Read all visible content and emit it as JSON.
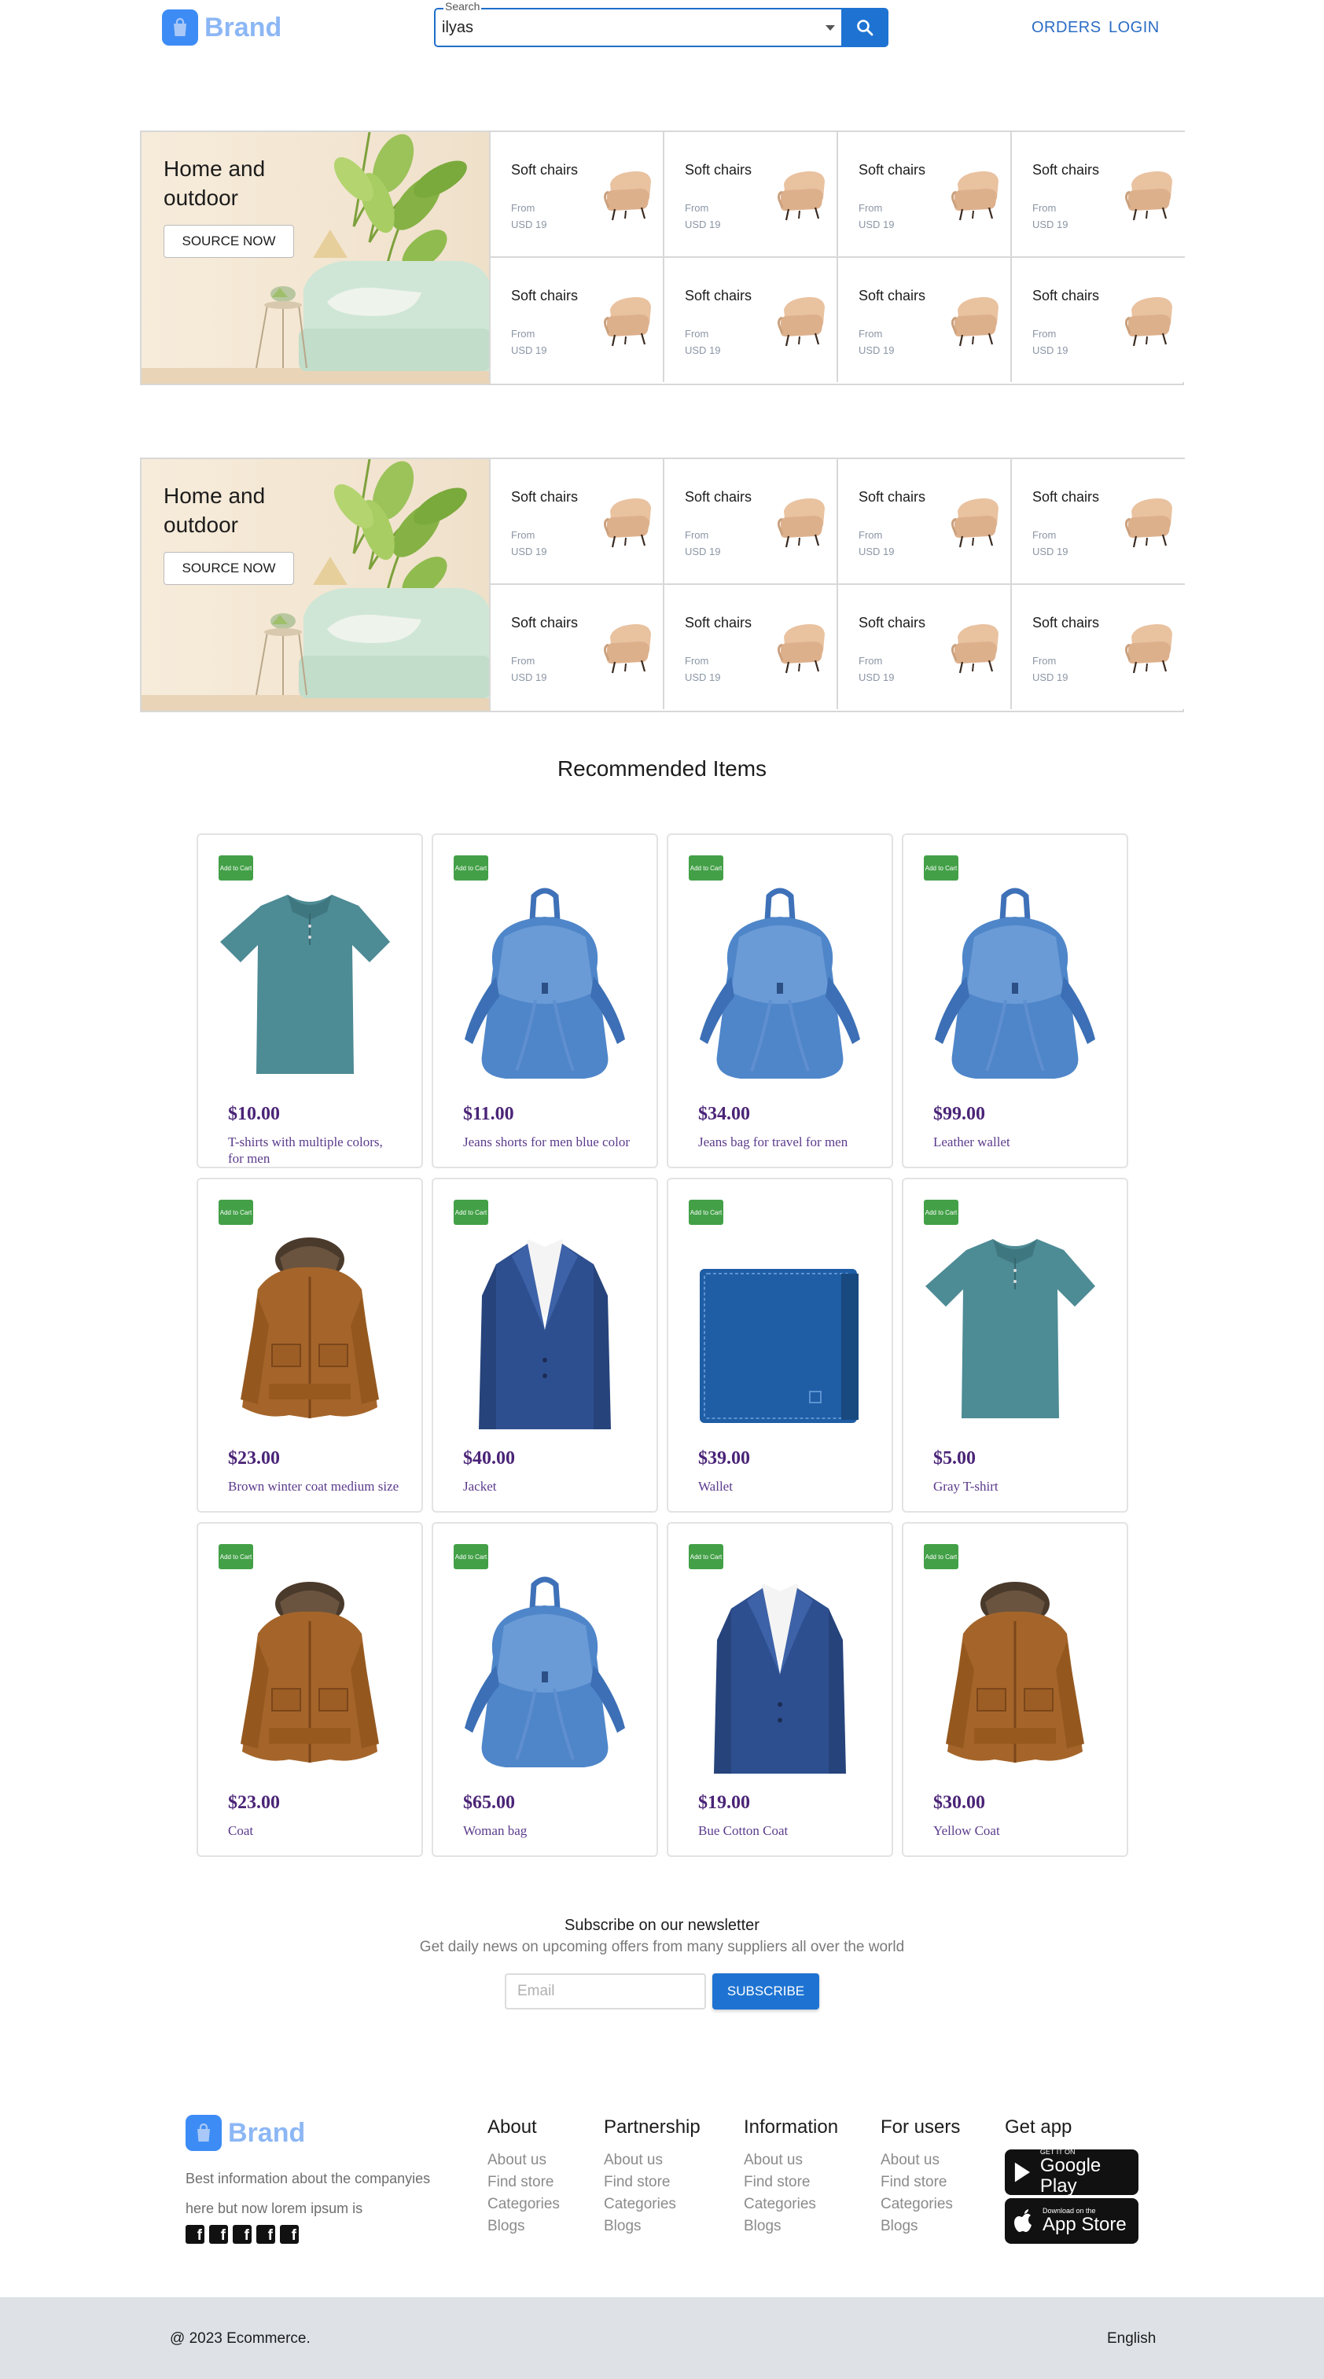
{
  "header": {
    "brand": "Brand",
    "search_label": "Search",
    "search_value": "ilyas",
    "nav_orders": "ORDERS",
    "nav_login": "LOGIN"
  },
  "category_blocks": [
    {
      "title": "Home and outdoor",
      "button": "SOURCE NOW",
      "cells": [
        {
          "title": "Soft chairs",
          "from": "From",
          "price": "USD 19"
        },
        {
          "title": "Soft chairs",
          "from": "From",
          "price": "USD 19"
        },
        {
          "title": "Soft chairs",
          "from": "From",
          "price": "USD 19"
        },
        {
          "title": "Soft chairs",
          "from": "From",
          "price": "USD 19"
        },
        {
          "title": "Soft chairs",
          "from": "From",
          "price": "USD 19"
        },
        {
          "title": "Soft chairs",
          "from": "From",
          "price": "USD 19"
        },
        {
          "title": "Soft chairs",
          "from": "From",
          "price": "USD 19"
        },
        {
          "title": "Soft chairs",
          "from": "From",
          "price": "USD 19"
        }
      ]
    },
    {
      "title": "Home and outdoor",
      "button": "SOURCE NOW",
      "cells": [
        {
          "title": "Soft chairs",
          "from": "From",
          "price": "USD 19"
        },
        {
          "title": "Soft chairs",
          "from": "From",
          "price": "USD 19"
        },
        {
          "title": "Soft chairs",
          "from": "From",
          "price": "USD 19"
        },
        {
          "title": "Soft chairs",
          "from": "From",
          "price": "USD 19"
        },
        {
          "title": "Soft chairs",
          "from": "From",
          "price": "USD 19"
        },
        {
          "title": "Soft chairs",
          "from": "From",
          "price": "USD 19"
        },
        {
          "title": "Soft chairs",
          "from": "From",
          "price": "USD 19"
        },
        {
          "title": "Soft chairs",
          "from": "From",
          "price": "USD 19"
        }
      ]
    }
  ],
  "recommended": {
    "title": "Recommended Items",
    "add_to_cart": "Add to Cart",
    "items": [
      {
        "price": "$10.00",
        "name": "T-shirts with multiple colors, for men",
        "image": "tshirt"
      },
      {
        "price": "$11.00",
        "name": "Jeans shorts for men blue color",
        "image": "backpack"
      },
      {
        "price": "$34.00",
        "name": "Jeans bag for travel for men",
        "image": "backpack"
      },
      {
        "price": "$99.00",
        "name": "Leather wallet",
        "image": "backpack"
      },
      {
        "price": "$23.00",
        "name": "Brown winter coat medium size",
        "image": "coat"
      },
      {
        "price": "$40.00",
        "name": "Jacket",
        "image": "blazer"
      },
      {
        "price": "$39.00",
        "name": "Wallet",
        "image": "wallet"
      },
      {
        "price": "$5.00",
        "name": "Gray T-shirt",
        "image": "tshirt"
      },
      {
        "price": "$23.00",
        "name": "Coat",
        "image": "coat"
      },
      {
        "price": "$65.00",
        "name": "Woman bag",
        "image": "backpack"
      },
      {
        "price": "$19.00",
        "name": "Bue Cotton Coat",
        "image": "blazer"
      },
      {
        "price": "$30.00",
        "name": "Yellow Coat",
        "image": "coat"
      }
    ]
  },
  "newsletter": {
    "title": "Subscribe on our newsletter",
    "subtitle": "Get daily news on upcoming offers from many suppliers all over the world",
    "email_placeholder": "Email",
    "button": "SUBSCRIBE"
  },
  "footer": {
    "brand": "Brand",
    "description": "Best information about the companyies here but now lorem ipsum is",
    "columns": [
      {
        "title": "About",
        "links": [
          "About us",
          "Find store",
          "Categories",
          "Blogs"
        ]
      },
      {
        "title": "Partnership",
        "links": [
          "About us",
          "Find store",
          "Categories",
          "Blogs"
        ]
      },
      {
        "title": "Information",
        "links": [
          "About us",
          "Find store",
          "Categories",
          "Blogs"
        ]
      },
      {
        "title": "For users",
        "links": [
          "About us",
          "Find store",
          "Categories",
          "Blogs"
        ]
      }
    ],
    "get_app": "Get app",
    "google_small": "GET IT ON",
    "google_big": "Google Play",
    "apple_small": "Download on the",
    "apple_big": "App Store",
    "copyright": "@ 2023 Ecommerce.",
    "language": "English"
  },
  "colors": {
    "primary": "#1e73d2",
    "brand_logo": "#3d8cf5",
    "add_to_cart": "#43a047",
    "price": "#4a2477",
    "bottom_bar": "#dee2e7"
  }
}
